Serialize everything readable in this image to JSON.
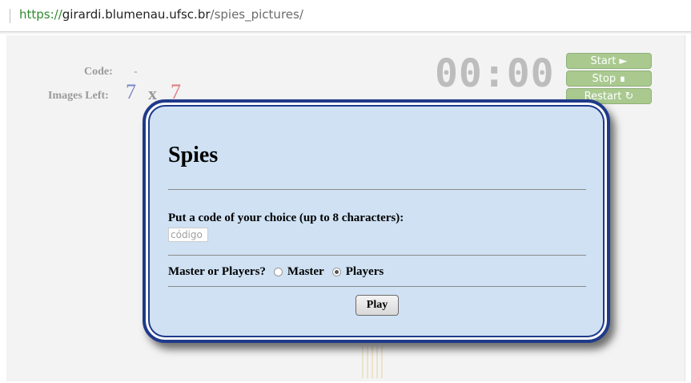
{
  "browser": {
    "url_scheme": "https://",
    "url_host": "girardi.blumenau.ufsc.br",
    "url_path": "/spies_pictures/"
  },
  "game": {
    "code_label": "Code:",
    "code_value": "-",
    "images_left_label": "Images Left:",
    "images_left_a": "7",
    "images_left_sep": "x",
    "images_left_b": "7",
    "timer": "00:00",
    "start_label": "Start ►",
    "stop_label": "Stop ∎",
    "restart_label": "Restart ↻"
  },
  "modal": {
    "title": "Spies",
    "prompt": "Put a code of your choice (up to 8 characters):",
    "code_placeholder": "código",
    "role_question": "Master or Players?",
    "role_master": "Master",
    "role_players": "Players",
    "selected_role": "Players",
    "play_label": "Play"
  },
  "colors": {
    "modal_bg": "#cfe1f3",
    "modal_border": "#1f3a8a",
    "control_green": "#a9c98f",
    "blue_count": "#7a86c6",
    "red_count": "#e07a7a"
  }
}
